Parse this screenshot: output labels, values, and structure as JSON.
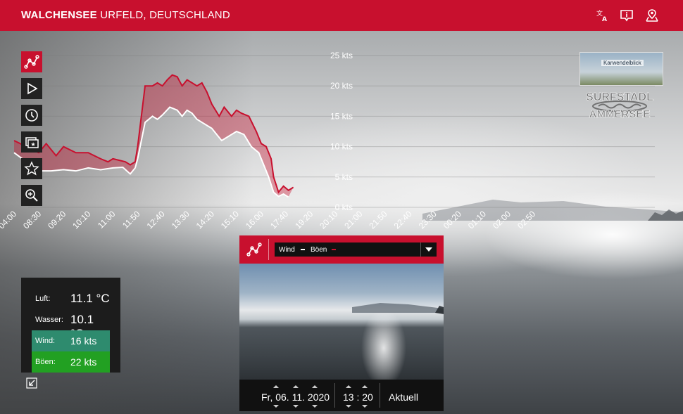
{
  "header": {
    "location_bold": "WALCHENSEE",
    "location_rest": " URFELD, DEUTSCHLAND"
  },
  "header_icons": [
    "translate-icon",
    "info-icon",
    "location-icon"
  ],
  "sidebar": {
    "buttons": [
      "chart-icon",
      "play-icon",
      "history-icon",
      "gallery-icon",
      "favorite-icon",
      "zoom-icon"
    ]
  },
  "chart_data": {
    "type": "area",
    "x_ticks": [
      "04:00",
      "08:30",
      "09:20",
      "10:10",
      "11:00",
      "11:50",
      "12:40",
      "13:30",
      "14:20",
      "15:10",
      "16:00",
      "17:40",
      "19:20",
      "20:10",
      "21:00",
      "21:50",
      "22:40",
      "23:30",
      "00:20",
      "01:10",
      "02:00",
      "02:50"
    ],
    "y_ticks": [
      "25 kts",
      "20 kts",
      "15 kts",
      "10 kts",
      "5 kts",
      "0 kts"
    ],
    "ylim": [
      0,
      25
    ],
    "series": [
      {
        "name": "Böen",
        "color": "#c8102e",
        "points": [
          [
            0,
            11
          ],
          [
            1,
            9
          ],
          [
            1.3,
            10.5
          ],
          [
            1.7,
            8.5
          ],
          [
            2,
            10
          ],
          [
            2.5,
            9
          ],
          [
            3,
            9
          ],
          [
            3.5,
            8
          ],
          [
            3.8,
            7.5
          ],
          [
            4,
            8
          ],
          [
            4.5,
            7.5
          ],
          [
            4.7,
            7
          ],
          [
            4.9,
            7.5
          ],
          [
            5,
            10
          ],
          [
            5.3,
            20
          ],
          [
            5.6,
            20
          ],
          [
            5.8,
            20.5
          ],
          [
            6,
            20
          ],
          [
            6.2,
            21
          ],
          [
            6.4,
            21.8
          ],
          [
            6.6,
            21.5
          ],
          [
            6.8,
            20
          ],
          [
            7,
            21
          ],
          [
            7.2,
            20.5
          ],
          [
            7.4,
            20
          ],
          [
            7.6,
            20.5
          ],
          [
            7.8,
            19
          ],
          [
            8,
            17
          ],
          [
            8.3,
            15
          ],
          [
            8.5,
            16.5
          ],
          [
            8.8,
            15
          ],
          [
            9,
            16
          ],
          [
            9.2,
            15.5
          ],
          [
            9.5,
            15
          ],
          [
            9.8,
            12.5
          ],
          [
            10,
            10.5
          ],
          [
            10.2,
            10
          ],
          [
            10.4,
            8
          ],
          [
            10.5,
            5
          ],
          [
            10.7,
            2.5
          ],
          [
            10.9,
            3.5
          ],
          [
            11.1,
            2.8
          ],
          [
            11.3,
            3.3
          ]
        ]
      },
      {
        "name": "Wind",
        "color": "#ffffff",
        "points": [
          [
            0,
            9
          ],
          [
            0.5,
            7.5
          ],
          [
            1,
            6
          ],
          [
            1.5,
            6
          ],
          [
            2,
            6.2
          ],
          [
            2.5,
            6
          ],
          [
            3,
            6.5
          ],
          [
            3.5,
            6.2
          ],
          [
            4,
            6.5
          ],
          [
            4.4,
            6.6
          ],
          [
            4.7,
            5.5
          ],
          [
            4.9,
            6.5
          ],
          [
            5,
            8
          ],
          [
            5.3,
            14
          ],
          [
            5.6,
            15
          ],
          [
            5.8,
            14.5
          ],
          [
            6,
            15.2
          ],
          [
            6.3,
            16.5
          ],
          [
            6.6,
            16
          ],
          [
            6.8,
            15
          ],
          [
            7,
            16
          ],
          [
            7.2,
            15.5
          ],
          [
            7.4,
            14.5
          ],
          [
            7.6,
            14
          ],
          [
            7.8,
            13.5
          ],
          [
            8,
            13
          ],
          [
            8.2,
            12
          ],
          [
            8.4,
            11
          ],
          [
            8.6,
            11.5
          ],
          [
            8.8,
            12
          ],
          [
            9,
            12.5
          ],
          [
            9.3,
            12
          ],
          [
            9.6,
            10
          ],
          [
            9.9,
            9
          ],
          [
            10.1,
            7
          ],
          [
            10.3,
            5
          ],
          [
            10.5,
            2.5
          ],
          [
            10.7,
            1.8
          ],
          [
            10.9,
            2.2
          ],
          [
            11.1,
            1.7
          ]
        ]
      }
    ]
  },
  "logos": {
    "webcam_label": "Karwendelblick",
    "brand_line1": "SURFSTADL",
    "brand_line2": "AMMERSEE"
  },
  "panel": {
    "legend_wind": "Wind",
    "legend_gust": "Böen",
    "date": "Fr, 06. 11. 2020",
    "time": "13 : 20",
    "current_button": "Aktuell"
  },
  "weather": {
    "air_label": "Luft:",
    "air_value": "11.1 °C",
    "water_label": "Wasser:",
    "water_value": "10.1 °C",
    "wind_label": "Wind:",
    "wind_value": "16 kts",
    "wind_color": "#2e8b6e",
    "gust_label": "Böen:",
    "gust_value": "22 kts",
    "gust_color": "#22a022"
  }
}
